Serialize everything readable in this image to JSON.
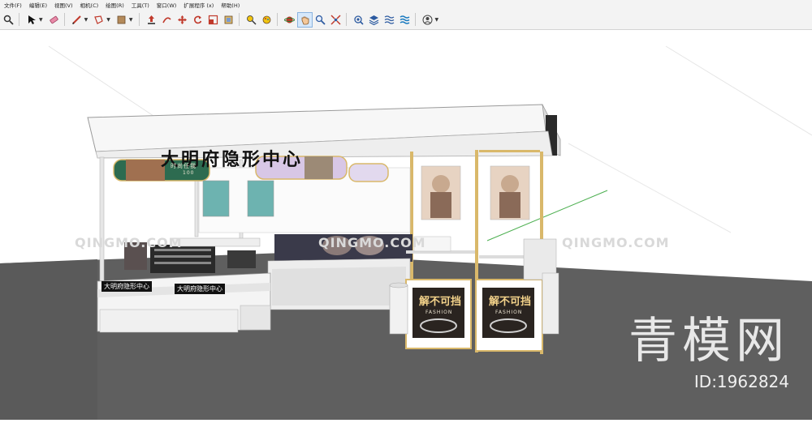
{
  "menu": {
    "items": [
      "文件(F)",
      "编辑(E)",
      "视图(V)",
      "相机(C)",
      "绘图(R)",
      "工具(T)",
      "窗口(W)",
      "扩展程序 (x)",
      "帮助(H)"
    ]
  },
  "toolbar": {
    "icons": [
      "search-icon",
      "select-arrow-icon",
      "eraser-icon",
      "pencil-icon",
      "shape-icon",
      "paint-bucket-icon",
      "push-pull-icon",
      "follow-me-icon",
      "move-icon",
      "rotate-icon",
      "scale-icon",
      "offset-icon",
      "tape-measure-icon",
      "paint-icon",
      "orbit-icon",
      "pan-icon",
      "zoom-icon",
      "zoom-extents-icon",
      "sandbox-icon",
      "layers-icon",
      "section-icon",
      "sections-icon",
      "user-icon"
    ]
  },
  "scene": {
    "shop_sign": "大明府隐形中心",
    "counter_label_1": "大明府隐形中心",
    "counter_label_2": "大明府隐形中心",
    "poster_text_1": "解不可挡",
    "poster_text_2": "解不可挡",
    "poster_sub": "FASHION",
    "banner_text": "时尚任我",
    "banner_sub": "100",
    "watermark_text": "QINGMO.COM",
    "brand_text": "青模网",
    "id_label": "ID:1962824"
  },
  "colors": {
    "floor": "#5c5c5c",
    "sky": "#ffffff",
    "booth": "#f2f2f2",
    "gold_trim": "#d9b86a"
  }
}
